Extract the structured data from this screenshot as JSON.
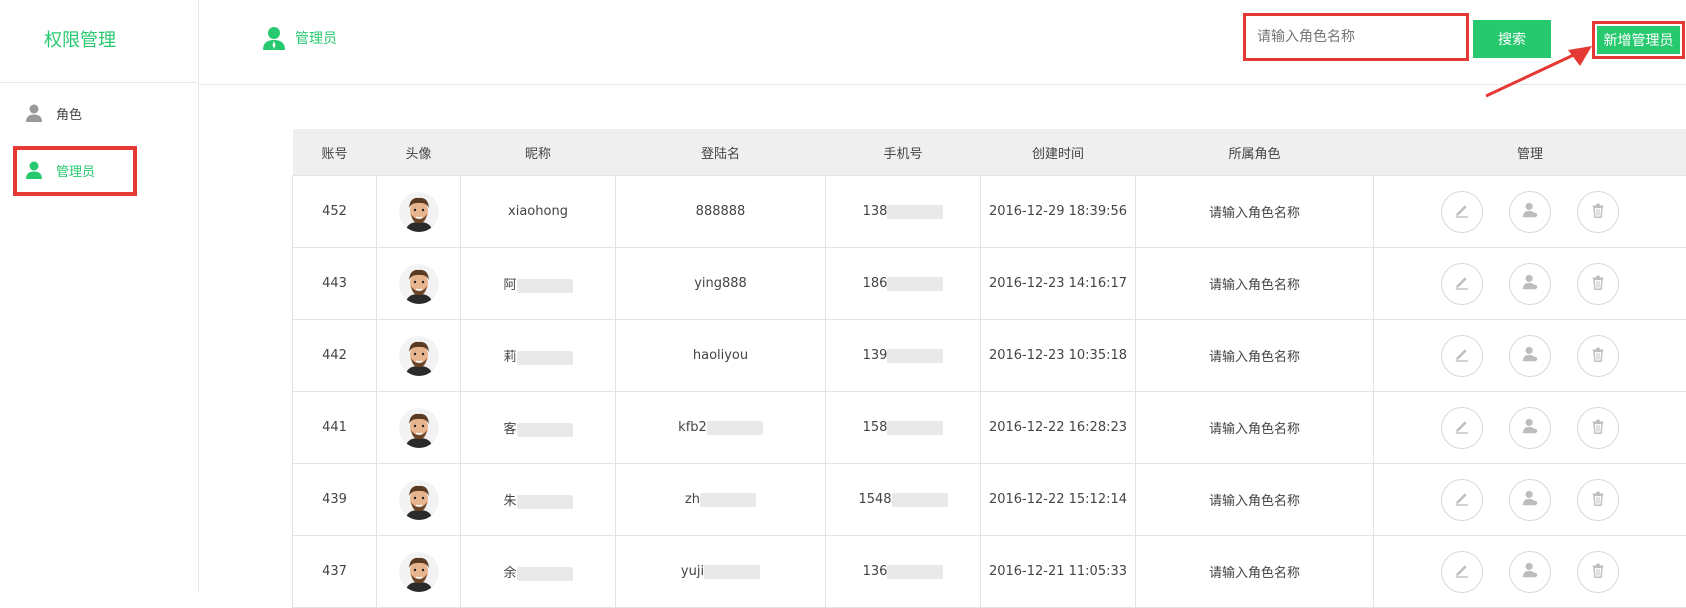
{
  "sidebar": {
    "brand": "权限管理",
    "items": [
      {
        "label": "角色",
        "icon": "user-gray-icon",
        "active": false
      },
      {
        "label": "管理员",
        "icon": "user-green-icon",
        "active": true
      }
    ]
  },
  "header": {
    "title": "管理员",
    "search_placeholder": "请输入角色名称",
    "search_button": "搜索",
    "add_button": "新增管理员"
  },
  "colors": {
    "accent": "#27c96f",
    "highlight": "#e53935"
  },
  "table": {
    "columns": [
      "账号",
      "头像",
      "昵称",
      "登陆名",
      "手机号",
      "创建时间",
      "所属角色",
      "管理"
    ],
    "rows": [
      {
        "id": "452",
        "nick": "xiaohong",
        "login": "888888",
        "phone": "138",
        "created": "2016-12-29 18:39:56",
        "role": "请输入角色名称"
      },
      {
        "id": "443",
        "nick": "阿",
        "login": "ying888",
        "phone": "186",
        "created": "2016-12-23 14:16:17",
        "role": "请输入角色名称"
      },
      {
        "id": "442",
        "nick": "莉",
        "login": "haoliyou",
        "phone": "139",
        "created": "2016-12-23 10:35:18",
        "role": "请输入角色名称"
      },
      {
        "id": "441",
        "nick": "客",
        "login": "kfb2",
        "phone": "158",
        "created": "2016-12-22 16:28:23",
        "role": "请输入角色名称"
      },
      {
        "id": "439",
        "nick": "朱",
        "login": "zh",
        "phone": "1548",
        "created": "2016-12-22 15:12:14",
        "role": "请输入角色名称"
      },
      {
        "id": "437",
        "nick": "余",
        "login": "yuji",
        "phone": "136",
        "created": "2016-12-21 11:05:33",
        "role": "请输入角色名称"
      }
    ]
  }
}
